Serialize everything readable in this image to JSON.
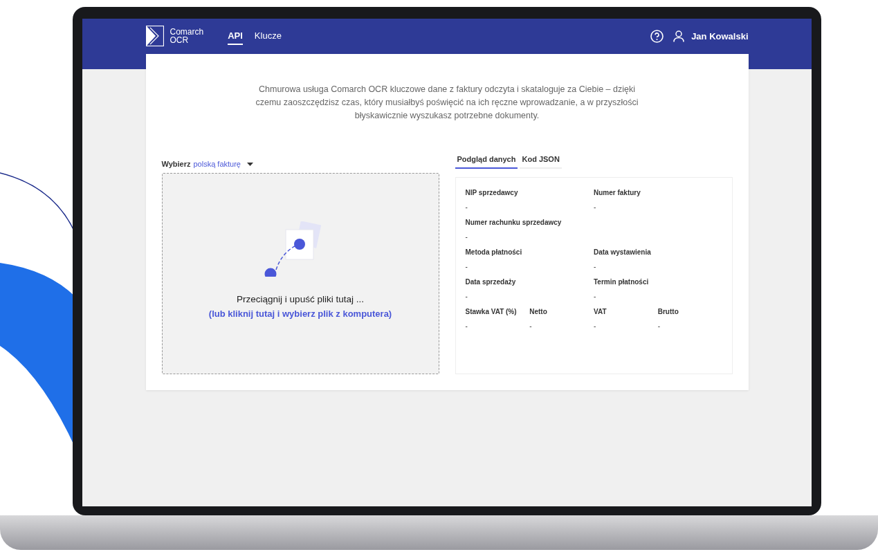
{
  "header": {
    "logo": {
      "line1": "Comarch",
      "line2": "OCR"
    },
    "nav": [
      {
        "label": "API",
        "selected": true
      },
      {
        "label": "Klucze",
        "selected": false
      }
    ],
    "user": "Jan Kowalski"
  },
  "intro": "Chmurowa usługa Comarch OCR kluczowe dane z faktury odczyta i skataloguje za Ciebie – dzięki czemu zaoszczędzisz czas, który musiałbyś poświęcić na ich ręczne wprowadzanie, a w przyszłości błyskawicznie wyszukasz potrzebne dokumenty.",
  "selector": {
    "label": "Wybierz",
    "value": "polską fakturę"
  },
  "dropzone": {
    "title": "Przeciągnij i upuść pliki tutaj ...",
    "link": "(lub kliknij tutaj i wybierz plik z komputera)"
  },
  "tabs": [
    {
      "label": "Podgląd danych",
      "selected": true
    },
    {
      "label": "Kod JSON",
      "selected": false
    }
  ],
  "fields": [
    [
      {
        "kind": "half",
        "label": "NIP sprzedawcy",
        "value": "-"
      },
      {
        "kind": "half",
        "label": "Numer faktury",
        "value": "-"
      }
    ],
    [
      {
        "kind": "half",
        "label": "Numer rachunku sprzedawcy",
        "value": "-"
      }
    ],
    [
      {
        "kind": "half",
        "label": "Metoda płatności",
        "value": "-"
      },
      {
        "kind": "half",
        "label": "Data wystawienia",
        "value": "-"
      }
    ],
    [
      {
        "kind": "half",
        "label": "Data sprzedaży",
        "value": "-"
      },
      {
        "kind": "half",
        "label": "Termin płatności",
        "value": "-"
      }
    ],
    [
      {
        "kind": "quarter",
        "label": "Stawka VAT (%)",
        "value": "-"
      },
      {
        "kind": "quarter",
        "label": "Netto",
        "value": "-"
      },
      {
        "kind": "quarter",
        "label": "VAT",
        "value": "-"
      },
      {
        "kind": "quarter",
        "label": "Brutto",
        "value": "-"
      }
    ]
  ]
}
